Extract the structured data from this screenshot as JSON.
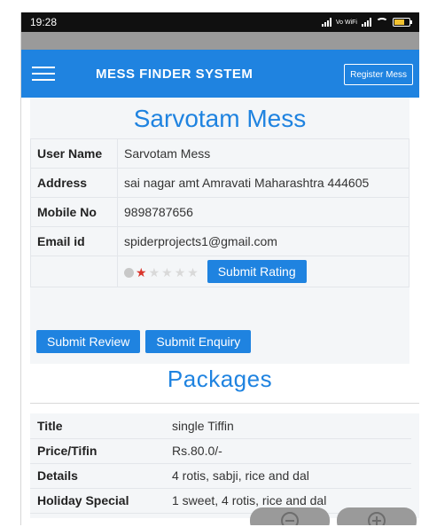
{
  "status_bar": {
    "time": "19:28",
    "network_label": "Vo WiFi"
  },
  "navbar": {
    "title": "MESS FINDER SYSTEM",
    "register_button": "Register Mess"
  },
  "mess": {
    "name": "Sarvotam Mess",
    "fields": [
      {
        "key": "User Name",
        "value": "Sarvotam Mess"
      },
      {
        "key": "Address",
        "value": "sai nagar amt Amravati Maharashtra 444605"
      },
      {
        "key": "Mobile No",
        "value": "9898787656"
      },
      {
        "key": "Email id",
        "value": "spiderprojects1@gmail.com"
      }
    ],
    "rating": {
      "value": 1,
      "max": 5
    },
    "submit_rating_label": "Submit Rating"
  },
  "actions": {
    "submit_review": "Submit Review",
    "submit_enquiry": "Submit Enquiry"
  },
  "packages": {
    "title": "Packages",
    "rows": [
      {
        "key": "Title",
        "value": "single Tiffin"
      },
      {
        "key": "Price/Tifin",
        "value": "Rs.80.0/-"
      },
      {
        "key": "Details",
        "value": "4 rotis, sabji, rice and dal"
      },
      {
        "key": "Holiday Special",
        "value": "1 sweet, 4 rotis, rice and dal"
      }
    ]
  },
  "colors": {
    "primary": "#1f83e0",
    "star_active": "#d9342b"
  },
  "icons": [
    "menu-icon",
    "signal-icon",
    "wifi-icon",
    "battery-icon",
    "zoom-out-icon",
    "zoom-in-icon"
  ]
}
